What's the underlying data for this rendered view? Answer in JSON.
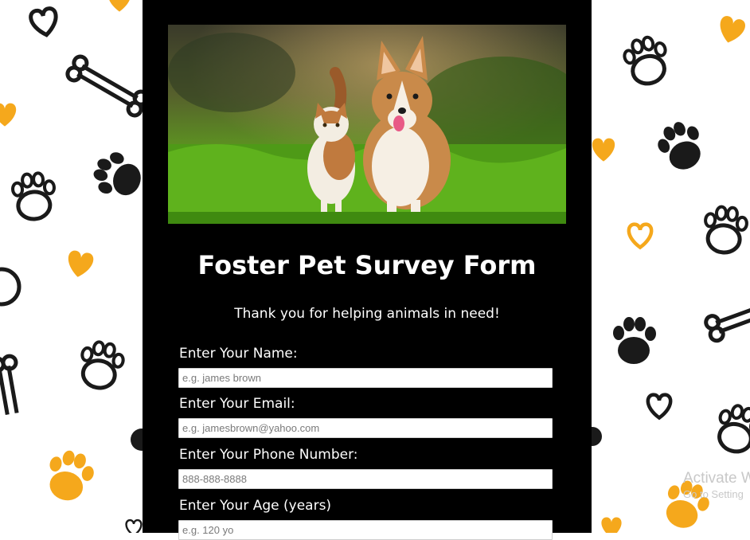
{
  "form": {
    "title": "Foster Pet Survey Form",
    "subtitle": "Thank you for helping animals in need!",
    "fields": [
      {
        "label": "Enter Your Name:",
        "placeholder": "e.g. james brown"
      },
      {
        "label": "Enter Your Email:",
        "placeholder": "e.g. jamesbrown@yahoo.com"
      },
      {
        "label": "Enter Your Phone Number:",
        "placeholder": "888-888-8888"
      },
      {
        "label": "Enter Your Age (years)",
        "placeholder": "e.g. 120 yo"
      }
    ]
  },
  "watermark": {
    "line1": "Activate W",
    "line2": "Go to Setting"
  },
  "colors": {
    "panel": "#000000",
    "paw_black": "#1a1a1a",
    "paw_orange": "#f5a81c",
    "text": "#ffffff"
  }
}
